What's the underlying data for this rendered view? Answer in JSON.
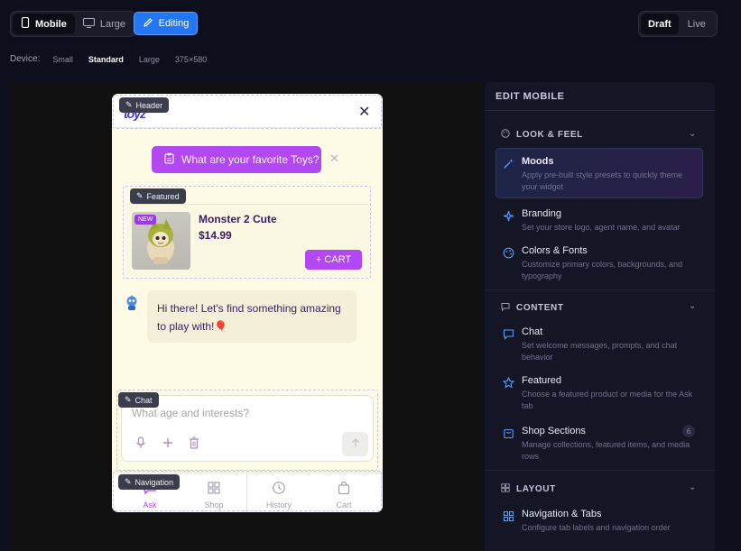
{
  "toolbar": {
    "view_options": [
      {
        "label": "Mobile",
        "icon": "phone-icon",
        "active": true
      },
      {
        "label": "Large",
        "icon": "monitor-icon",
        "active": false
      }
    ],
    "editing_label": "Editing",
    "status_options": [
      {
        "label": "Draft",
        "active": true
      },
      {
        "label": "Live",
        "active": false
      }
    ]
  },
  "device": {
    "label": "Device:",
    "options": [
      "Small",
      "Standard",
      "Large",
      "375×580"
    ],
    "selected": "Standard"
  },
  "widget": {
    "logo_text": "toyz",
    "tags": {
      "header": "Header",
      "featured": "Featured",
      "chat": "Chat",
      "navigation": "Navigation"
    },
    "prompt_pill": "What are your favorite Toys?",
    "featured": {
      "badge": "NEW",
      "name": "Monster 2 Cute",
      "price": "$14.99",
      "cart_label": "+ CART"
    },
    "bot_message": "Hi there! Let's find something amazing to play with!🎈",
    "composer_placeholder": "What age and interests?",
    "nav": [
      {
        "label": "Ask",
        "icon": "chat-icon",
        "active": true
      },
      {
        "label": "Shop",
        "icon": "grid-icon",
        "active": false
      },
      {
        "label": "History",
        "icon": "clock-icon",
        "active": false
      },
      {
        "label": "Cart",
        "icon": "bag-icon",
        "active": false
      }
    ]
  },
  "panel": {
    "title": "EDIT MOBILE",
    "sections": [
      {
        "title": "LOOK & FEEL",
        "items": [
          {
            "title": "Moods",
            "desc": "Apply pre-built style presets to quickly theme your widget"
          },
          {
            "title": "Branding",
            "desc": "Set your store logo, agent name, and avatar"
          },
          {
            "title": "Colors & Fonts",
            "desc": "Customize primary colors, backgrounds, and typography"
          }
        ]
      },
      {
        "title": "CONTENT",
        "items": [
          {
            "title": "Chat",
            "desc": "Set welcome messages, prompts, and chat behavior"
          },
          {
            "title": "Featured",
            "desc": "Choose a featured product or media for the Ask tab"
          },
          {
            "title": "Shop Sections",
            "desc": "Manage collections, featured items, and media rows",
            "count": "6"
          }
        ]
      },
      {
        "title": "LAYOUT",
        "items": [
          {
            "title": "Navigation & Tabs",
            "desc": "Configure tab labels and navigation order"
          }
        ]
      }
    ]
  },
  "colors": {
    "accent": "#b148f2",
    "editing": "#2477f4",
    "widget_bg": "#fdfbe6",
    "panel_bg": "#141525"
  }
}
